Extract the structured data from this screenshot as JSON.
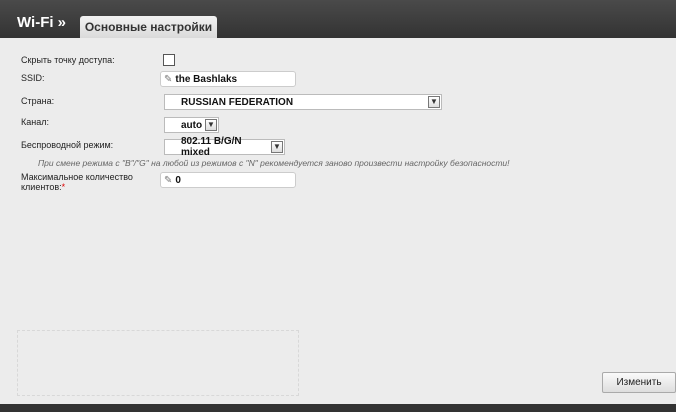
{
  "header": {
    "title": "Wi-Fi »",
    "tab_label": "Основные настройки"
  },
  "form": {
    "hide_ap_label": "Скрыть точку доступа:",
    "ssid_label": "SSID:",
    "ssid_value": "the Bashlaks",
    "country_label": "Страна:",
    "country_value": "RUSSIAN FEDERATION",
    "channel_label": "Канал:",
    "channel_value": "auto",
    "mode_label": "Беспроводной режим:",
    "mode_value": "802.11 B/G/N mixed",
    "hint": "При смене режима с \"B\"/\"G\" на любой из режимов с \"N\" рекомендуется заново произвести настройку безопасности!",
    "max_clients_label_line1": "Максимальное количество",
    "max_clients_label_line2": "клиентов:",
    "required_mark": "*",
    "max_clients_value": "0"
  },
  "actions": {
    "apply_label": "Изменить"
  },
  "icons": {
    "input_edit": "pencil-icon",
    "select_arrow": "chevron-down-icon"
  }
}
